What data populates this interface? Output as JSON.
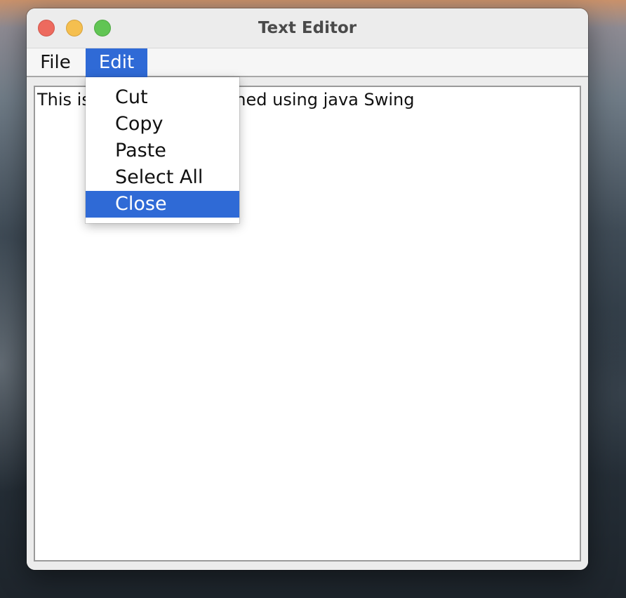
{
  "window": {
    "title": "Text Editor"
  },
  "menubar": {
    "file_label": "File",
    "edit_label": "Edit"
  },
  "editor": {
    "text": "This is Text editor deisgned using java Swing"
  },
  "edit_menu": {
    "items": [
      {
        "label": "Cut"
      },
      {
        "label": "Copy"
      },
      {
        "label": "Paste"
      },
      {
        "label": "Select All"
      },
      {
        "label": "Close"
      }
    ],
    "highlighted_item": "Close"
  },
  "colors": {
    "menu_highlight": "#2f6ad6",
    "traffic_close": "#ed6a5e",
    "traffic_minimize": "#f5bf4f",
    "traffic_maximize": "#61c554",
    "window_background": "#ececec"
  }
}
